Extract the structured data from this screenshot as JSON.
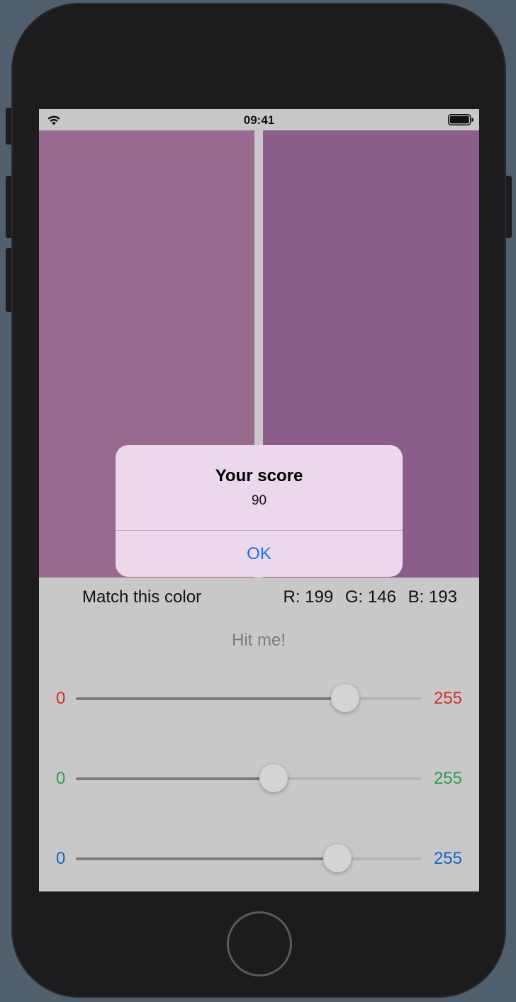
{
  "status_bar": {
    "time": "09:41",
    "wifi_icon": "wifi-icon",
    "battery_icon": "battery-icon"
  },
  "swatches": {
    "target_color": "#986a90",
    "guess_color": "#8b5d89"
  },
  "info": {
    "match_label": "Match this color",
    "r_text": "R: 199",
    "g_text": "G: 146",
    "b_text": "B: 193"
  },
  "hit_button_label": "Hit me!",
  "sliders": [
    {
      "channel": "red",
      "min_label": "0",
      "max_label": "255",
      "value": 199,
      "max": 255,
      "color": "#d0312d"
    },
    {
      "channel": "green",
      "min_label": "0",
      "max_label": "255",
      "value": 146,
      "max": 255,
      "color": "#2e9e4a"
    },
    {
      "channel": "blue",
      "min_label": "0",
      "max_label": "255",
      "value": 193,
      "max": 255,
      "color": "#1565c0"
    }
  ],
  "alert": {
    "title": "Your score",
    "message": "90",
    "ok_label": "OK",
    "ok_color": "#1a73e8"
  }
}
